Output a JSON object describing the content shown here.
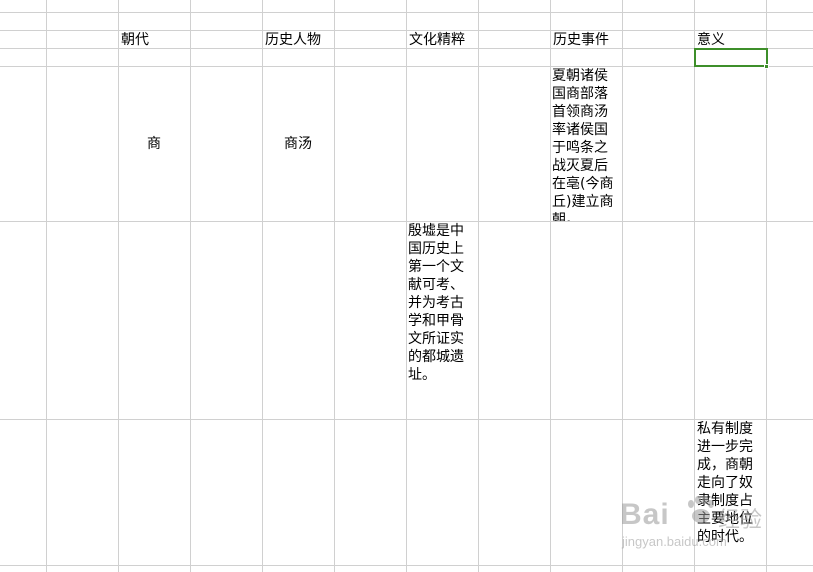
{
  "spreadsheet": {
    "headers": {
      "dynasty": "朝代",
      "figure": "历史人物",
      "culture": "文化精粹",
      "event": "历史事件",
      "significance": "意义"
    },
    "row_shang": {
      "dynasty": "商",
      "figure": "商汤",
      "event": "夏朝诸侯国商部落首领商汤率诸侯国于鸣条之战灭夏后在亳(今商丘)建立商朝。"
    },
    "row_yinxu": {
      "culture": "殷墟是中国历史上第一个文献可考、并为考古学和甲骨文所证实的都城遗址。"
    },
    "row_private": {
      "significance": "私有制度进一步完成，商朝走向了奴隶制度占主要地位的时代。"
    }
  },
  "watermark": {
    "brand": "Bai",
    "suffix": "经验",
    "url": "jingyan.baidu.com"
  },
  "colors": {
    "grid": "#d0d0d0",
    "selection": "#3e8f2a"
  }
}
